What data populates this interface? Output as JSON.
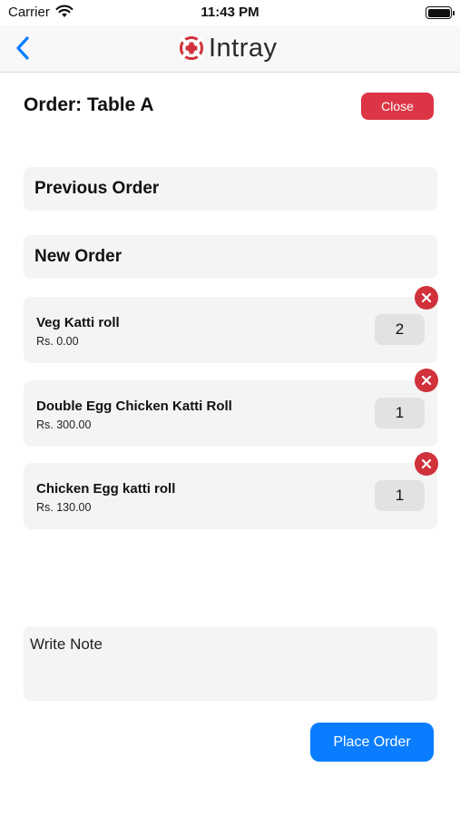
{
  "status_bar": {
    "carrier": "Carrier",
    "time": "11:43 PM"
  },
  "nav": {
    "brand": "Intray",
    "icons": [
      "back-chevron-icon",
      "intray-logo-icon"
    ]
  },
  "order": {
    "title": "Order: Table A",
    "close_label": "Close"
  },
  "sections": {
    "previous_order": "Previous Order",
    "new_order": "New Order"
  },
  "items": [
    {
      "name": "Veg Katti roll",
      "price": "Rs. 0.00",
      "qty": "2"
    },
    {
      "name": "Double Egg Chicken Katti Roll",
      "price": "Rs. 300.00",
      "qty": "1"
    },
    {
      "name": "Chicken Egg katti roll",
      "price": "Rs. 130.00",
      "qty": "1"
    }
  ],
  "note": {
    "placeholder": "Write Note"
  },
  "actions": {
    "place_order": "Place Order"
  },
  "colors": {
    "accent": "#0a7dff",
    "danger": "#dc3545",
    "remove": "#d0313b",
    "card": "#f4f4f4"
  }
}
